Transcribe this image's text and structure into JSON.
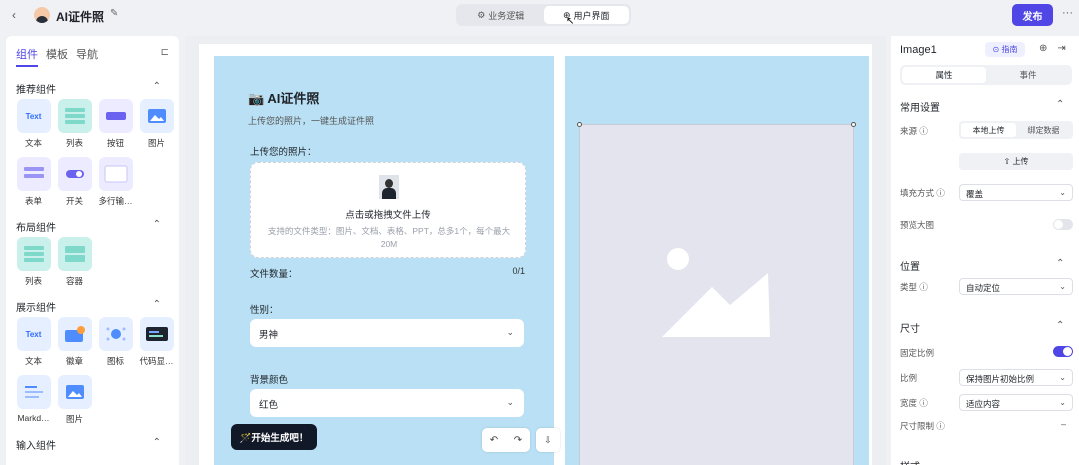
{
  "topbar": {
    "back_glyph": "‹",
    "app_title": "AI证件照",
    "edit_glyph": "✎",
    "mode_tabs": [
      {
        "label": "业务逻辑",
        "icon": "flow-icon",
        "active": false
      },
      {
        "label": "用户界面",
        "icon": "ui-icon",
        "active": true
      }
    ],
    "publish_label": "发布",
    "more_glyph": "···"
  },
  "left_panel": {
    "tabs": [
      {
        "label": "组件",
        "active": true
      },
      {
        "label": "模板",
        "active": false
      },
      {
        "label": "导航",
        "active": false
      }
    ],
    "sections": [
      {
        "title": "推荐组件",
        "items": [
          {
            "label": "文本",
            "icon": "text-icon",
            "glyph": "Text"
          },
          {
            "label": "列表",
            "icon": "list-icon",
            "glyph": ""
          },
          {
            "label": "按钮",
            "icon": "button-icon",
            "glyph": ""
          },
          {
            "label": "图片",
            "icon": "image-icon",
            "glyph": ""
          },
          {
            "label": "表单",
            "icon": "form-icon",
            "glyph": ""
          },
          {
            "label": "开关",
            "icon": "switch-icon",
            "glyph": ""
          },
          {
            "label": "多行输…",
            "icon": "textarea-icon",
            "glyph": ""
          }
        ]
      },
      {
        "title": "布局组件",
        "items": [
          {
            "label": "列表",
            "icon": "list-layout-icon",
            "glyph": ""
          },
          {
            "label": "容器",
            "icon": "container-icon",
            "glyph": ""
          }
        ]
      },
      {
        "title": "展示组件",
        "items": [
          {
            "label": "文本",
            "icon": "text-display-icon",
            "glyph": "Text"
          },
          {
            "label": "徽章",
            "icon": "badge-icon",
            "glyph": ""
          },
          {
            "label": "图标",
            "icon": "icon-component-icon",
            "glyph": ""
          },
          {
            "label": "代码显…",
            "icon": "code-icon",
            "glyph": ""
          },
          {
            "label": "Markd…",
            "icon": "markdown-icon",
            "glyph": ""
          },
          {
            "label": "图片",
            "icon": "image-display-icon",
            "glyph": ""
          }
        ]
      },
      {
        "title": "输入组件",
        "items": []
      }
    ]
  },
  "canvas": {
    "title": "📷 AI证件照",
    "subtitle": "上传您的照片，一键生成证件照",
    "upload_label": "上传您的照片：",
    "upload_title": "点击或拖拽文件上传",
    "upload_hint": "支持的文件类型：图片、文档、表格、PPT，总多1个，每个最大 20M",
    "file_count_label": "文件数量：",
    "file_count_value": "0/1",
    "gender_label": "性别：",
    "gender_value": "男神",
    "bg_label": "背景颜色",
    "bg_value": "红色",
    "generate_label": "🪄开始生成吧！",
    "undo_glyph": "↶",
    "redo_glyph": "↷",
    "export_glyph": "⇩"
  },
  "right_panel": {
    "title": "Image1",
    "tag": "⊙ 指南",
    "tabs": [
      {
        "label": "属性",
        "active": true
      },
      {
        "label": "事件",
        "active": false
      }
    ],
    "common": {
      "title": "常用设置",
      "source_label": "来源 ⓘ",
      "source_options": [
        {
          "label": "本地上传",
          "active": true
        },
        {
          "label": "绑定数据",
          "active": false
        }
      ],
      "upload_button": "⇧ 上传",
      "fill_label": "填充方式 ⓘ",
      "fill_value": "覆盖",
      "preview_label": "预览大图",
      "preview_on": false
    },
    "position": {
      "title": "位置",
      "type_label": "类型 ⓘ",
      "type_value": "自动定位"
    },
    "size": {
      "title": "尺寸",
      "fixed_ratio_label": "固定比例",
      "fixed_ratio_on": true,
      "ratio_label": "比例",
      "ratio_value": "保持图片初始比例",
      "width_label": "宽度 ⓘ",
      "width_value": "适应内容",
      "limit_label": "尺寸限制 ⓘ",
      "limit_value": "–"
    },
    "next_section": "样式"
  },
  "colors": {
    "accent": "#4f46e5",
    "canvas_bg": "#b9e0f4",
    "image_placeholder": "#e3e4ee"
  }
}
